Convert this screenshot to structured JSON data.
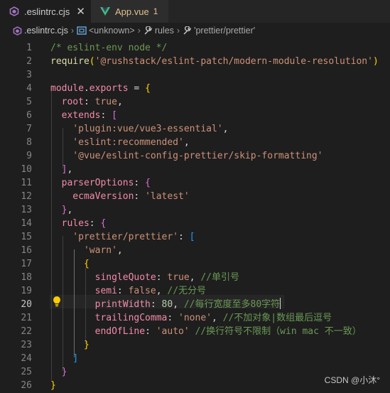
{
  "tabs": [
    {
      "label": ".eslintrc.cjs",
      "icon": "eslint-icon",
      "active": true,
      "close": "✕"
    },
    {
      "label": "App.vue",
      "icon": "vue-icon",
      "active": false,
      "badge": "1"
    }
  ],
  "breadcrumbs": {
    "file": ".eslintrc.cjs",
    "crumb2": "<unknown>",
    "crumb3": "rules",
    "crumb4": "'prettier/prettier'",
    "separator": "›"
  },
  "editor": {
    "current_line": 20,
    "line_numbers": [
      "1",
      "2",
      "3",
      "4",
      "5",
      "6",
      "7",
      "8",
      "9",
      "10",
      "11",
      "12",
      "13",
      "14",
      "15",
      "16",
      "17",
      "18",
      "19",
      "20",
      "21",
      "22",
      "23",
      "24",
      "25",
      "26"
    ],
    "lines": [
      [
        {
          "t": "/* eslint-env node */",
          "c": "comment"
        }
      ],
      [
        {
          "t": "require",
          "c": "fn"
        },
        {
          "t": "(",
          "c": "b1"
        },
        {
          "t": "'@rushstack/eslint-patch/modern-module-resolution'",
          "c": "str"
        },
        {
          "t": ")",
          "c": "b1"
        }
      ],
      [],
      [
        {
          "t": "module",
          "c": "prop"
        },
        {
          "t": ".",
          "c": "plain"
        },
        {
          "t": "exports",
          "c": "prop"
        },
        {
          "t": " = ",
          "c": "plain"
        },
        {
          "t": "{",
          "c": "b1"
        }
      ],
      [
        {
          "t": "  root",
          "c": "key"
        },
        {
          "t": ": ",
          "c": "plain"
        },
        {
          "t": "true",
          "c": "str"
        },
        {
          "t": ",",
          "c": "plain"
        }
      ],
      [
        {
          "t": "  extends",
          "c": "key"
        },
        {
          "t": ": ",
          "c": "plain"
        },
        {
          "t": "[",
          "c": "b2"
        }
      ],
      [
        {
          "t": "    'plugin:vue/vue3-essential'",
          "c": "str"
        },
        {
          "t": ",",
          "c": "plain"
        }
      ],
      [
        {
          "t": "    'eslint:recommended'",
          "c": "str"
        },
        {
          "t": ",",
          "c": "plain"
        }
      ],
      [
        {
          "t": "    '@vue/eslint-config-prettier/skip-formatting'",
          "c": "str"
        }
      ],
      [
        {
          "t": "  ",
          "c": "plain"
        },
        {
          "t": "]",
          "c": "b2"
        },
        {
          "t": ",",
          "c": "plain"
        }
      ],
      [
        {
          "t": "  parserOptions",
          "c": "key"
        },
        {
          "t": ": ",
          "c": "plain"
        },
        {
          "t": "{",
          "c": "b2"
        }
      ],
      [
        {
          "t": "    ecmaVersion",
          "c": "key"
        },
        {
          "t": ": ",
          "c": "plain"
        },
        {
          "t": "'latest'",
          "c": "str"
        }
      ],
      [
        {
          "t": "  ",
          "c": "plain"
        },
        {
          "t": "}",
          "c": "b2"
        },
        {
          "t": ",",
          "c": "plain"
        }
      ],
      [
        {
          "t": "  rules",
          "c": "key"
        },
        {
          "t": ": ",
          "c": "plain"
        },
        {
          "t": "{",
          "c": "b2"
        }
      ],
      [
        {
          "t": "    'prettier/prettier'",
          "c": "str"
        },
        {
          "t": ": ",
          "c": "plain"
        },
        {
          "t": "[",
          "c": "b3"
        }
      ],
      [
        {
          "t": "      'warn'",
          "c": "str"
        },
        {
          "t": ",",
          "c": "plain"
        }
      ],
      [
        {
          "t": "      ",
          "c": "plain"
        },
        {
          "t": "{",
          "c": "b1"
        }
      ],
      [
        {
          "t": "        singleQuote",
          "c": "key"
        },
        {
          "t": ": ",
          "c": "plain"
        },
        {
          "t": "true",
          "c": "str"
        },
        {
          "t": ", ",
          "c": "plain"
        },
        {
          "t": "//单引号",
          "c": "comment"
        }
      ],
      [
        {
          "t": "        semi",
          "c": "key"
        },
        {
          "t": ": ",
          "c": "plain"
        },
        {
          "t": "false",
          "c": "str"
        },
        {
          "t": ", ",
          "c": "plain"
        },
        {
          "t": "//无分号",
          "c": "comment"
        }
      ],
      [
        {
          "t": "        printWidth",
          "c": "key"
        },
        {
          "t": ": ",
          "c": "plain"
        },
        {
          "t": "80",
          "c": "num"
        },
        {
          "t": ", ",
          "c": "plain"
        },
        {
          "t": "//每行宽度至多80字符",
          "c": "comment"
        }
      ],
      [
        {
          "t": "        trailingComma",
          "c": "key"
        },
        {
          "t": ": ",
          "c": "plain"
        },
        {
          "t": "'none'",
          "c": "str"
        },
        {
          "t": ", ",
          "c": "plain"
        },
        {
          "t": "//不加对象|数组最后逗号",
          "c": "comment"
        }
      ],
      [
        {
          "t": "        endOfLine",
          "c": "key"
        },
        {
          "t": ": ",
          "c": "plain"
        },
        {
          "t": "'auto'",
          "c": "str"
        },
        {
          "t": " ",
          "c": "plain"
        },
        {
          "t": "//换行符号不限制（win mac 不一致）",
          "c": "comment"
        }
      ],
      [
        {
          "t": "      ",
          "c": "plain"
        },
        {
          "t": "}",
          "c": "b1"
        }
      ],
      [
        {
          "t": "    ",
          "c": "plain"
        },
        {
          "t": "]",
          "c": "b3"
        }
      ],
      [
        {
          "t": "  ",
          "c": "plain"
        },
        {
          "t": "}",
          "c": "b2"
        }
      ],
      [
        {
          "t": "}",
          "c": "b1"
        }
      ]
    ]
  },
  "watermark": "CSDN @小沐°",
  "colors": {
    "background": "#1e1e1e",
    "tabbar": "#252526",
    "comment": "#6a9955",
    "string": "#ce9178",
    "property": "#f38ba8",
    "bracket1": "#ffd700",
    "bracket2": "#da70d6",
    "bracket3": "#179fff",
    "lightbulb": "#ffcc00"
  }
}
